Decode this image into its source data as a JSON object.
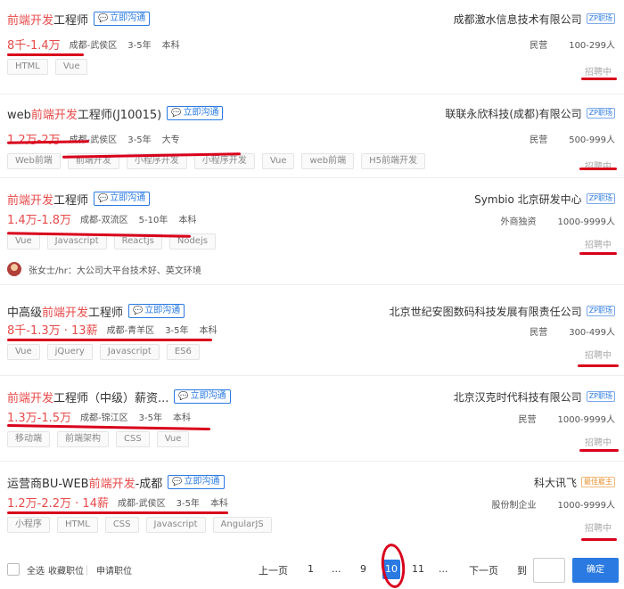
{
  "jobs": [
    {
      "title_prefix": "",
      "title_highlight": "前端开发",
      "title_suffix": "工程师",
      "chat_label": "立即沟通",
      "salary": "8千-1.4万",
      "location": "成都-武侯区",
      "experience": "3-5年",
      "education": "本科",
      "tags": [
        "HTML",
        "Vue"
      ],
      "company": "成都激水信息技术有限公司",
      "company_badge": "ZP职场",
      "company_type": "民营",
      "company_size": "100-299人",
      "status": "招聘中"
    },
    {
      "title_prefix": "web",
      "title_highlight": "前端开发",
      "title_suffix": "工程师(J10015)",
      "chat_label": "立即沟通",
      "salary": "1.2万-2万",
      "location": "成都-武侯区",
      "experience": "3-5年",
      "education": "大专",
      "tags": [
        "Web前端",
        "前端开发",
        "小程序开发",
        "小程序开发",
        "Vue",
        "web前端",
        "H5前端开发"
      ],
      "company": "联联永欣科技(成都)有限公司",
      "company_badge": "ZP职场",
      "company_type": "民营",
      "company_size": "500-999人",
      "status": "招聘中"
    },
    {
      "title_prefix": "",
      "title_highlight": "前端开发",
      "title_suffix": "工程师",
      "chat_label": "立即沟通",
      "salary": "1.4万-1.8万",
      "location": "成都-双流区",
      "experience": "5-10年",
      "education": "本科",
      "tags": [
        "Vue",
        "Javascript",
        "Reactjs",
        "Nodejs"
      ],
      "company": "Symbio 北京研发中心",
      "company_badge": "ZP职场",
      "company_type": "外商独资",
      "company_size": "1000-9999人",
      "status": "招聘中"
    },
    {
      "title_prefix": "中高级",
      "title_highlight": "前端开发",
      "title_suffix": "工程师",
      "chat_label": "立即沟通",
      "salary": "8千-1.3万 · 13薪",
      "location": "成都-青羊区",
      "experience": "3-5年",
      "education": "本科",
      "tags": [
        "Vue",
        "jQuery",
        "Javascript",
        "ES6"
      ],
      "company": "北京世纪安图数码科技发展有限责任公司",
      "company_badge": "ZP职场",
      "company_type": "民营",
      "company_size": "300-499人",
      "status": "招聘中"
    },
    {
      "title_prefix": "",
      "title_highlight": "前端开发",
      "title_suffix": "工程师（中级）薪资...",
      "chat_label": "立即沟通",
      "salary": "1.3万-1.5万",
      "location": "成都-锦江区",
      "experience": "3-5年",
      "education": "本科",
      "tags": [
        "移动端",
        "前端架构",
        "CSS",
        "Vue"
      ],
      "company": "北京汉克时代科技有限公司",
      "company_badge": "ZP职场",
      "company_type": "民营",
      "company_size": "1000-9999人",
      "status": "招聘中"
    },
    {
      "title_prefix": "运营商BU-WEB",
      "title_highlight": "前端开发",
      "title_suffix": "-成都",
      "chat_label": "立即沟通",
      "salary": "1.2万-2.2万 · 14薪",
      "location": "成都-武侯区",
      "experience": "3-5年",
      "education": "本科",
      "tags": [
        "小程序",
        "HTML",
        "CSS",
        "Javascript",
        "AngularJS"
      ],
      "company": "科大讯飞",
      "company_badge": "最佳雇主",
      "company_type": "股份制企业",
      "company_size": "1000-9999人",
      "status": "招聘中"
    }
  ],
  "recruiter": {
    "text": "张女士/hr：大公司大平台技术好、英文环境"
  },
  "footer": {
    "select_all": "全选",
    "favorite": "收藏职位",
    "apply": "申请职位",
    "prev": "上一页",
    "pages": [
      "1",
      "...",
      "9",
      "10",
      "11",
      "..."
    ],
    "next": "下一页",
    "goto": "到",
    "confirm": "确定"
  },
  "colors": {
    "accent": "#2a7ae2",
    "highlight": "#e84a4a",
    "annotation": "#d9001b"
  }
}
